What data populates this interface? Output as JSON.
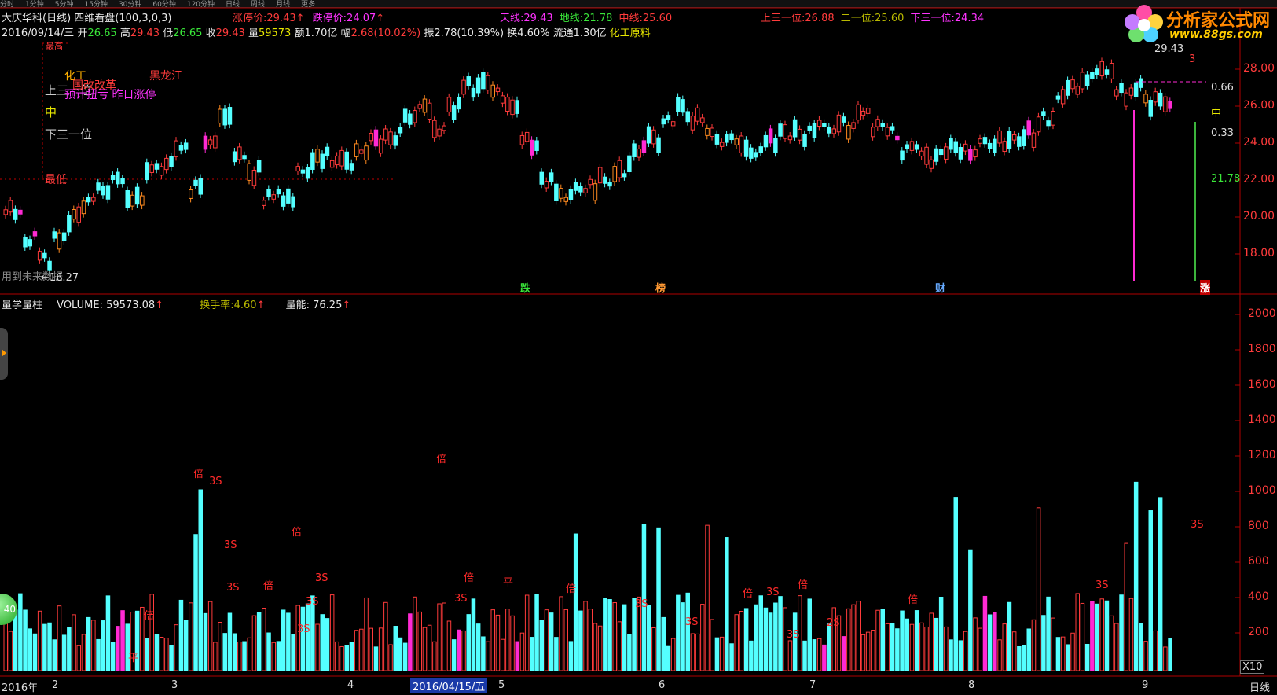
{
  "menu": [
    "分时",
    "1分钟",
    "5分钟",
    "15分钟",
    "30分钟",
    "60分钟",
    "120分钟",
    "日线",
    "周线",
    "月线",
    "更多"
  ],
  "header": {
    "stock_name": "大庆华科(日线)",
    "indicator": "四维看盘(100,3,0,3)",
    "limit_up_label": "涨停价:",
    "limit_up_value": "29.43",
    "limit_down_label": "跌停价:",
    "limit_down_value": "24.07",
    "sky_label": "天线:",
    "sky_value": "29.43",
    "ground_label": "地线:",
    "ground_value": "21.78",
    "mid_label": "中线:",
    "mid_value": "25.60",
    "upper_label": "上三一位:",
    "upper_value": "26.88",
    "second_label": "二一位:",
    "second_value": "25.60",
    "lower_label": "下三一位:",
    "lower_value": "24.34"
  },
  "quote": {
    "date": "2016/09/14/三",
    "open_label": "开",
    "open": "26.65",
    "high_label": "高",
    "high": "29.43",
    "low_label": "低",
    "low": "26.65",
    "close_label": "收",
    "close": "29.43",
    "vol_label": "量",
    "vol": "59573",
    "amount": "额1.70亿",
    "range_label": "幅",
    "range": "2.68(10.02%)",
    "amp": "振2.78(10.39%)",
    "turnover": "换4.60%",
    "float": "流通1.30亿",
    "industry": "化工原料"
  },
  "overlay": {
    "max_label": "最高",
    "upper": "上三一位",
    "mid": "中",
    "lower": "下三一位",
    "min_label": "最低",
    "tag_chem": "化工",
    "tag_plan": "国改改革",
    "tag_region": "黑龙江",
    "tag_zt": "预计扭亏 昨日涨停",
    "hint": "用到未来数据",
    "low_marker": "←16.27",
    "high_marker": "29.43",
    "marker_fall": "跌",
    "marker_rank": "榜",
    "marker_fin": "财",
    "marker_rise": "涨",
    "right_066": "0.66",
    "right_mid": "中",
    "right_033": "0.33",
    "right_value": "21.78",
    "right_top": "3"
  },
  "price_axis": [
    "28.00",
    "26.00",
    "24.00",
    "22.00",
    "20.00",
    "18.00"
  ],
  "volume_header": {
    "name": "量学量柱",
    "volume_label": "VOLUME:",
    "volume_value": "59573.08",
    "turnover_label": "换手率:",
    "turnover_value": "4.60",
    "energy_label": "量能:",
    "energy_value": "76.25"
  },
  "volume_axis": [
    "2000",
    "1800",
    "1600",
    "1400",
    "1200",
    "1000",
    "800",
    "600",
    "400",
    "200"
  ],
  "volume_unit": "X10",
  "date_axis": {
    "year": "2016年",
    "m2": "2",
    "m3": "3",
    "m4": "4",
    "selected": "2016/04/15/五",
    "m5": "5",
    "m6": "6",
    "m7": "7",
    "m8": "8",
    "m9": "9",
    "period": "日线"
  },
  "volume_tags": [
    "倍",
    "3S",
    "倍",
    "3S",
    "3S",
    "倍",
    "3S",
    "3S",
    "倍",
    "平",
    "倍",
    "倍",
    "倍",
    "3S",
    "3S",
    "平",
    "3S",
    "倍",
    "3S",
    "3S",
    "2S",
    "3S",
    "倍",
    "倍",
    "3S",
    "3S"
  ],
  "side_badge": "40",
  "logo": {
    "name": "分析家公式网",
    "url": "www.88gs.com"
  },
  "colors": {
    "up": "#ff3b3b",
    "down": "#54ffff",
    "magenta": "#ff2ad4",
    "orange": "#ff8a1f",
    "green": "#22e022",
    "grid_red": "#b00000",
    "axis_red": "#ff3b3b"
  }
}
